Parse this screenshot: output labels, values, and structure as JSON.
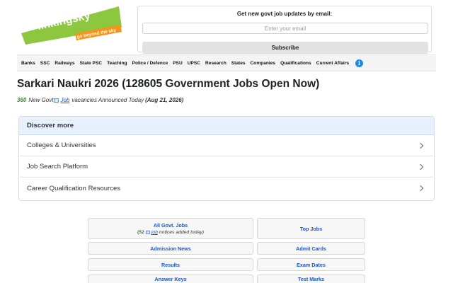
{
  "logo": {
    "name": "linkingsky",
    "tagline": "go beyond the sky"
  },
  "subscribe": {
    "title": "Get new govt job updates by email:",
    "email_placeholder": "Enter your email",
    "email_value": "",
    "button_label": "Subscribe"
  },
  "nav": {
    "items": [
      "Banks",
      "SSC",
      "Railways",
      "State PSC",
      "Teaching",
      "Police / Defence",
      "PSU",
      "UPSC",
      "Research",
      "States",
      "Companies",
      "Qualifications",
      "Current Affairs"
    ],
    "info_icon": "info-icon"
  },
  "page": {
    "title": "Sarkari Naukri 2026 (128605 Government Jobs Open Now)",
    "count": "360",
    "new_govt": "New Govt",
    "job_link": "Job",
    "rest": "vacancies Announced Today",
    "date": "(Aug 21, 2026)"
  },
  "discover": {
    "header": "Discover more",
    "items": [
      "Colleges & Universities",
      "Job Search Platform",
      "Career Qualification Resources"
    ]
  },
  "grid": {
    "all_govt_jobs": "All Govt. Jobs",
    "all_note_count": "(52",
    "all_note_link": "job",
    "all_note_rest": "notices added today)",
    "top_jobs": "Top Jobs",
    "admission_news": "Admission News",
    "admit_cards": "Admit Cards",
    "results": "Results",
    "exam_dates": "Exam Dates",
    "answer_keys": "Answer Keys",
    "test_marks": "Test Marks"
  },
  "colors": {
    "logo_green": "#8dc63f",
    "tagline_orange": "#f7941d",
    "link_blue": "#1a55c6",
    "count_green": "#2e8b2e",
    "discover_header": "#e8f0fe",
    "info_blue": "#1e88e5"
  }
}
